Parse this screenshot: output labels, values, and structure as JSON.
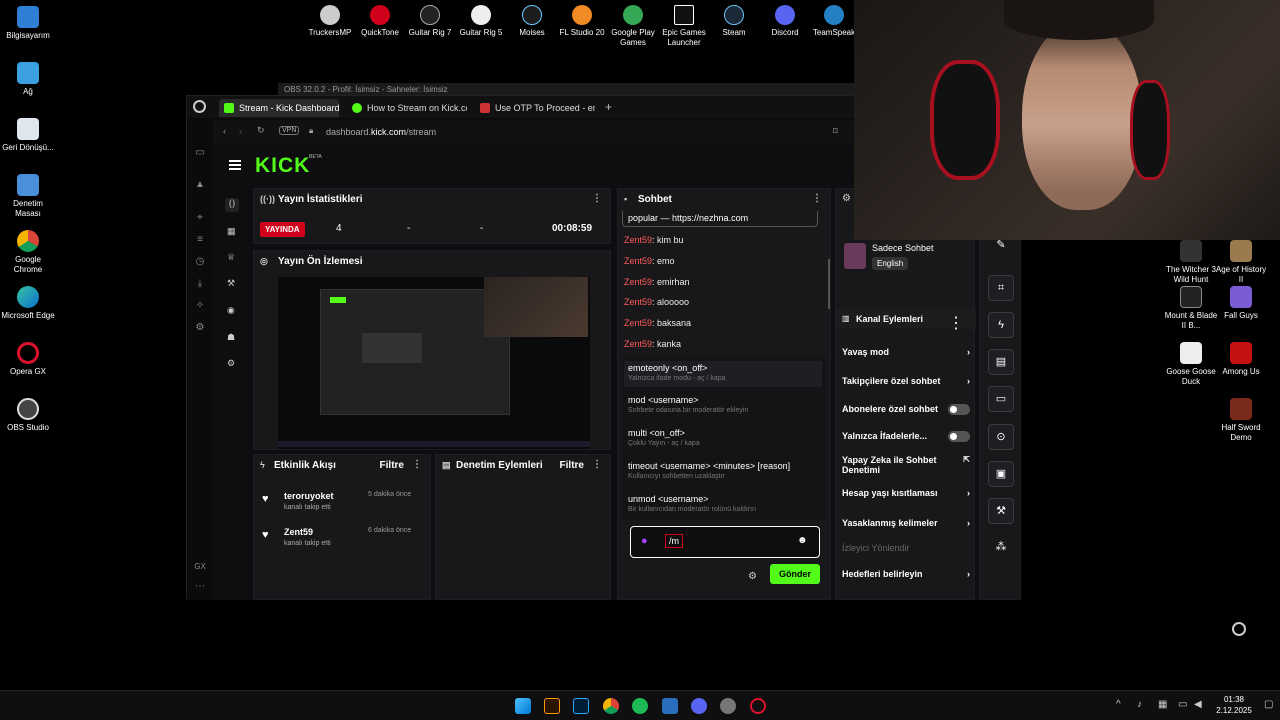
{
  "desktop": {
    "left_icons": [
      "Bilgisayarım",
      "Ağ",
      "Geri Dönüşü...",
      "Denetim Masası",
      "Google Chrome",
      "Microsoft Edge",
      "Opera GX",
      "OBS Studio"
    ],
    "top_icons": [
      "TruckersMP",
      "QuickTone",
      "Guitar Rig 7",
      "Guitar Rig 5",
      "Moises",
      "FL Studio 20",
      "Google Play Games",
      "Epic Games Launcher",
      "Steam",
      "Discord",
      "TeamSpeak"
    ],
    "right_icons": [
      "The Witcher 3 Wild Hunt",
      "Age of History II",
      "Mount & Blade II B...",
      "Fall Guys",
      "Goose Goose Duck",
      "Among Us",
      "Half Sword Demo"
    ]
  },
  "obs_title": "OBS 32.0.2 - Profil: İsimsiz - Sahneler: İsimsiz",
  "browser": {
    "tabs": [
      "Stream - Kick Dashboard",
      "How to Stream on Kick.co",
      "Use OTP To Proceed - en"
    ],
    "vpn": "VPN",
    "url_pre": "dashboard.",
    "url_domain": "kick.com",
    "url_path": "/stream",
    "gx": "GX"
  },
  "kick": {
    "logo": "KICK",
    "beta": "BETA"
  },
  "stats": {
    "title": "Yayın İstatistikleri",
    "live": "YAYINDA",
    "viewers": "4",
    "f2": "-",
    "f3": "-",
    "time": "00:08:59"
  },
  "preview": {
    "title": "Yayın Ön İzlemesi"
  },
  "activity": {
    "title": "Etkinlik Akışı",
    "filter": "Filtre",
    "items": [
      {
        "name": "teroruyoket",
        "time": "5 dakika önce",
        "desc": "kanalı takip etti"
      },
      {
        "name": "Zent59",
        "time": "6 dakika önce",
        "desc": "kanalı takip etti"
      }
    ]
  },
  "moderation": {
    "title": "Denetim Eylemleri",
    "filter": "Filtre"
  },
  "chat": {
    "title": "Sohbet",
    "pinned": "popular — https://nezhna.com",
    "lines": [
      {
        "user": "Zent59",
        "msg": ": kim bu"
      },
      {
        "user": "Zent59",
        "msg": ": emo"
      },
      {
        "user": "Zent59",
        "msg": ": emirhan"
      },
      {
        "user": "Zent59",
        "msg": ": alooooo"
      },
      {
        "user": "Zent59",
        "msg": ": baksana"
      },
      {
        "user": "Zent59",
        "msg": ": kanka"
      }
    ],
    "commands": [
      {
        "cmd": "emoteonly <on_off>",
        "desc": "Yalnızca ifade modu - aç / kapa"
      },
      {
        "cmd": "mod <username>",
        "desc": "Sohbete odasına bir moderatör ekleyin"
      },
      {
        "cmd": "multi <on_off>",
        "desc": "Çoklu Yayın - aç / kapa"
      },
      {
        "cmd": "timeout <username> <minutes> [reason]",
        "desc": "Kullanıcıyı sohbetten uzaklaştır"
      },
      {
        "cmd": "unmod <username>",
        "desc": "Bir kullanıcıdan moderatör rolünü kaldırın"
      }
    ],
    "input_value": "/m",
    "send": "Gönder"
  },
  "channel": {
    "name": "Sadece Sohbet",
    "language": "English",
    "actions_title": "Kanal Eylemleri",
    "rows": [
      "Yavaş mod",
      "Takipçilere özel sohbet",
      "Abonelere özel sohbet",
      "Yalnızca İfadelerle...",
      "Yapay Zeka ile Sohbet Denetimi",
      "Hesap yaşı kısıtlaması",
      "Yasaklanmış kelimeler"
    ],
    "section": "İzleyici Yönlendir",
    "goals": "Hedefleri belirleyin"
  },
  "taskbar": {
    "time": "01:38",
    "date": "2.12.2025"
  }
}
